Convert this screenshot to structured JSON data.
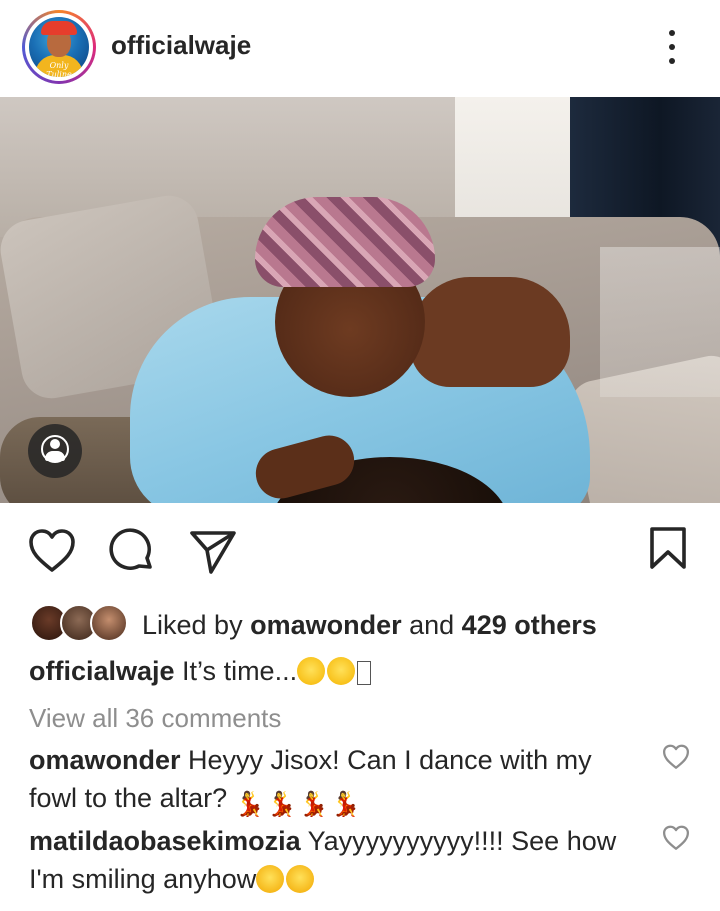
{
  "header": {
    "username": "officialwaje",
    "avatar_icon": "profile-avatar",
    "more_icon": "more-vertical-icon",
    "avatar_script": "Only Tuline"
  },
  "post": {
    "photo_alt": "",
    "tag_icon": "user-tag-icon"
  },
  "actions": {
    "like_icon": "heart-icon",
    "comment_icon": "comment-icon",
    "share_icon": "send-icon",
    "save_icon": "bookmark-icon"
  },
  "likes": {
    "prefix": "Liked by ",
    "user": "omawonder",
    "middle": " and ",
    "others": "429 others"
  },
  "caption": {
    "username": "officialwaje",
    "text": " It’s time..."
  },
  "view_all": "View all 36 comments",
  "comments": [
    {
      "username": "omawonder",
      "text": " Heyyy Jisox! Can I dance with my fowl to the altar? "
    },
    {
      "username": "matildaobasekimozia",
      "text": " Yayyyyyyyyyy!!!! See how I'm smiling anyhow"
    }
  ],
  "colors": {
    "text": "#262626",
    "muted": "#8e8e8e",
    "avatar_ring": [
      "#f58529",
      "#dd2a7b",
      "#8134af",
      "#515bd4"
    ]
  }
}
